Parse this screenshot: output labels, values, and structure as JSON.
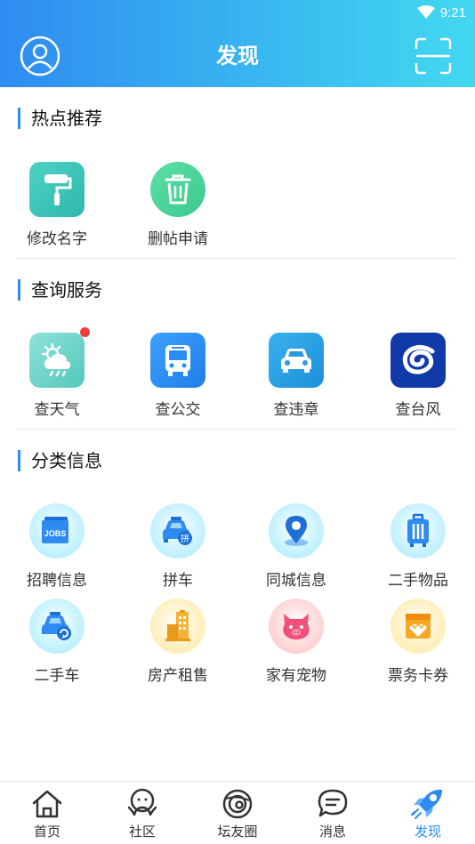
{
  "status": {
    "time": "9:21"
  },
  "header": {
    "title": "发现"
  },
  "sections": {
    "hot": {
      "title": "热点推荐",
      "items": [
        {
          "label": "修改名字",
          "icon": "paint-roller-icon"
        },
        {
          "label": "删帖申请",
          "icon": "trash-icon"
        }
      ]
    },
    "query": {
      "title": "查询服务",
      "items": [
        {
          "label": "查天气",
          "icon": "weather-icon",
          "has_notification": true
        },
        {
          "label": "查公交",
          "icon": "bus-icon"
        },
        {
          "label": "查违章",
          "icon": "car-icon"
        },
        {
          "label": "查台风",
          "icon": "typhoon-icon"
        }
      ]
    },
    "classified": {
      "title": "分类信息",
      "items": [
        {
          "label": "招聘信息",
          "icon": "jobs-icon",
          "badge_text": "JOBS"
        },
        {
          "label": "拼车",
          "icon": "carpool-icon",
          "badge_text": "拼"
        },
        {
          "label": "同城信息",
          "icon": "location-pin-icon"
        },
        {
          "label": "二手物品",
          "icon": "luggage-icon"
        },
        {
          "label": "二手车",
          "icon": "used-car-icon"
        },
        {
          "label": "房产租售",
          "icon": "building-icon"
        },
        {
          "label": "家有宠物",
          "icon": "pet-icon"
        },
        {
          "label": "票务卡券",
          "icon": "ticket-icon"
        }
      ]
    }
  },
  "bottom_nav": [
    {
      "label": "首页",
      "icon": "home-icon",
      "active": false
    },
    {
      "label": "社区",
      "icon": "community-icon",
      "active": false
    },
    {
      "label": "坛友圈",
      "icon": "planet-icon",
      "active": false
    },
    {
      "label": "消息",
      "icon": "message-icon",
      "active": false
    },
    {
      "label": "发现",
      "icon": "rocket-icon",
      "active": true
    }
  ],
  "colors": {
    "header_gradient_start": "#2f8bf0",
    "header_gradient_end": "#43d8f1",
    "accent": "#2f8bf0",
    "notification_dot": "#f23b3b"
  }
}
